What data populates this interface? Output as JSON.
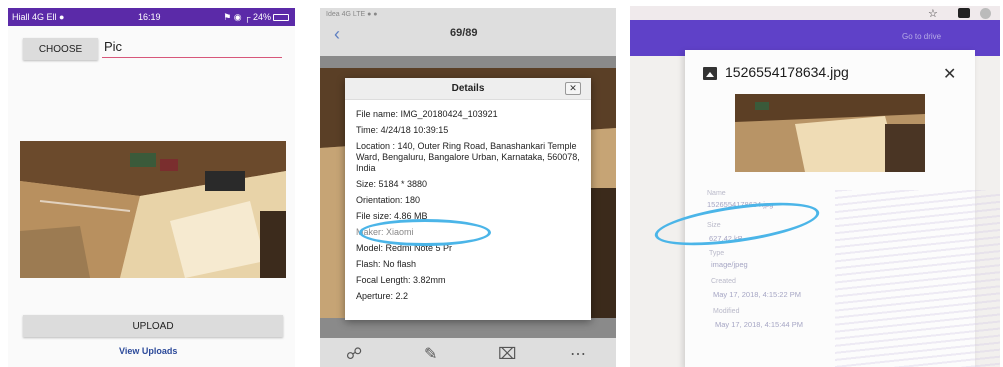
{
  "panel_app": {
    "status_bar": {
      "left": "Hiаll 4G Еll ●",
      "time": "16:19",
      "right": "⚑ ◉ ┌ 24%"
    },
    "choose_label": "CHOOSE",
    "name_value": "Pic",
    "upload_label": "UPLOAD",
    "view_uploads_label": "View Uploads",
    "colors": {
      "status_bar": "#5b2aa8",
      "underline": "#d7577a",
      "link": "#2c4a9a"
    }
  },
  "panel_gallery": {
    "status": "Idea 4G LTE ● ●",
    "back_icon": "chevron-left-icon",
    "counter": "69/89",
    "details": {
      "title": "Details",
      "close_label": "✕",
      "rows": [
        "File name: IMG_20180424_103921",
        "Time: 4/24/18 10:39:15",
        "Location : 140, Outer Ring Road, Banashankari Temple Ward, Bengaluru, Bangalore Urban, Karnataka, 560078, India",
        "Size: 5184 * 3880",
        "Orientation: 180",
        "File size: 4.86 MB",
        "Maker: Xiaomi",
        "Model: Redmi Note 5 Pr",
        "Flash: No flash",
        "Focal Length: 3.82mm",
        "Aperture: 2.2"
      ]
    },
    "bottom_icons": [
      "share-icon",
      "edit-icon",
      "trash-icon",
      "more-icon"
    ],
    "highlight_color": "#4bb5e8"
  },
  "panel_drive": {
    "top_icons": [
      "star-icon",
      "extension-icon",
      "avatar-icon"
    ],
    "goto_label": "Go to drive",
    "file_title": "1526554178634.jpg",
    "close_label": "✕",
    "meta": [
      {
        "label": "Name",
        "value": "1526554178634.jpg"
      },
      {
        "label": "Size",
        "value": "627.42 kB"
      },
      {
        "label": "Type",
        "value": "image/jpeg"
      },
      {
        "label": "Created",
        "value": "May 17, 2018, 4:15:22 PM"
      },
      {
        "label": "Modified",
        "value": "May 17, 2018, 4:15:44 PM"
      }
    ],
    "colors": {
      "header": "#5f41c8",
      "highlight": "#4bb5e8"
    }
  }
}
